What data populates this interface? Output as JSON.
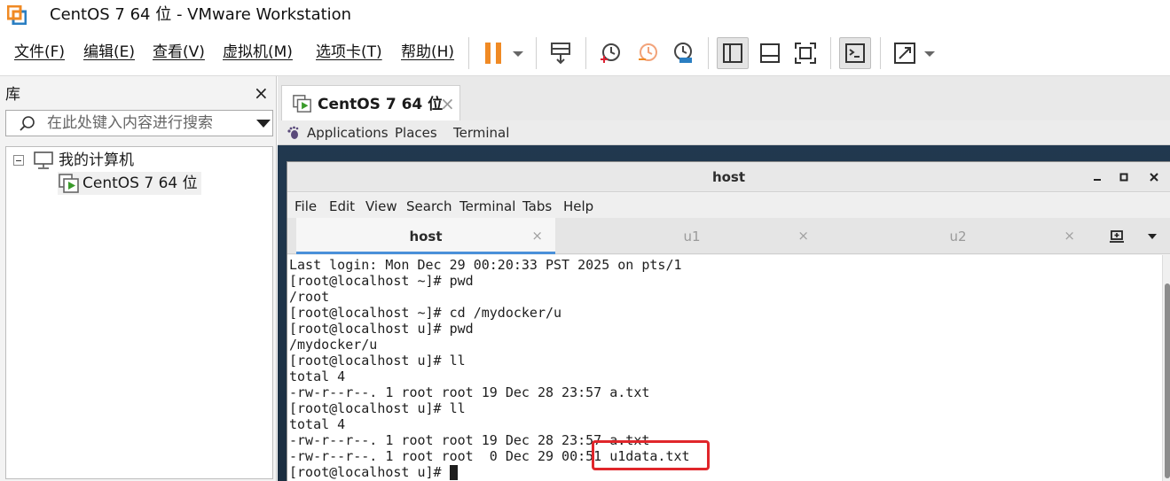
{
  "window": {
    "title": "CentOS 7 64 位 - VMware Workstation",
    "logo_icon": "vmware-logo-icon",
    "accent_color": "#f08a24"
  },
  "menubar": {
    "items": [
      {
        "label": "文件(F)",
        "name": "file"
      },
      {
        "label": "编辑(E)",
        "name": "edit"
      },
      {
        "label": "查看(V)",
        "name": "view"
      },
      {
        "label": "虚拟机(M)",
        "name": "vm"
      },
      {
        "label": "选项卡(T)",
        "name": "tabs"
      },
      {
        "label": "帮助(H)",
        "name": "help"
      }
    ],
    "toolbar_icons": [
      "pause-icon",
      "send-ctrl-alt-del-icon",
      "snapshot-take-icon",
      "snapshot-revert-icon",
      "snapshot-manager-icon",
      "show-library-icon",
      "thumbnail-bar-icon",
      "full-screen-icon",
      "console-view-icon",
      "stretch-icon"
    ]
  },
  "library": {
    "header": "库",
    "close": "×",
    "search_placeholder": "在此处键入内容进行搜索",
    "tree": {
      "root_label": "我的计算机",
      "vm_label": "CentOS 7 64 位"
    }
  },
  "vm_tab": {
    "label": "CentOS 7 64 位",
    "close": "×"
  },
  "guest_panel": {
    "items": [
      "Applications",
      "Places",
      "Terminal"
    ]
  },
  "terminal": {
    "title": "host",
    "menu": [
      "File",
      "Edit",
      "View",
      "Search",
      "Terminal",
      "Tabs",
      "Help"
    ],
    "tabs": [
      {
        "label": "host",
        "active": true
      },
      {
        "label": "u1",
        "active": false
      },
      {
        "label": "u2",
        "active": false
      }
    ],
    "tab_close": "×",
    "lines": [
      "Last login: Mon Dec 29 00:20:33 PST 2025 on pts/1",
      "[root@localhost ~]# pwd",
      "/root",
      "[root@localhost ~]# cd /mydocker/u",
      "[root@localhost u]# pwd",
      "/mydocker/u",
      "[root@localhost u]# ll",
      "total 4",
      "-rw-r--r--. 1 root root 19 Dec 28 23:57 a.txt",
      "[root@localhost u]# ll",
      "total 4",
      "-rw-r--r--. 1 root root 19 Dec 28 23:57 a.txt",
      "-rw-r--r--. 1 root root  0 Dec 29 00:51 u1data.txt",
      "[root@localhost u]# "
    ],
    "highlight_color": "#e0262b"
  }
}
